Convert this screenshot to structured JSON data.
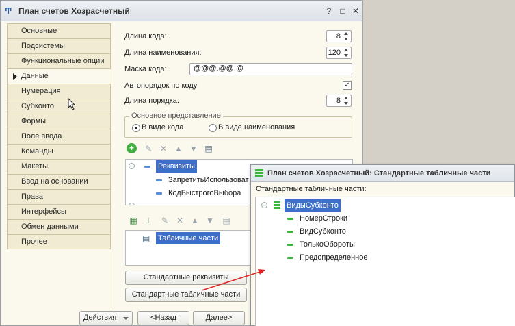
{
  "main_window": {
    "title": "План счетов Хозрасчетный",
    "icon": "chart-of-accounts-icon",
    "controls": [
      "?",
      "□",
      "✕"
    ]
  },
  "tabs": [
    {
      "label": "Основные",
      "active": false
    },
    {
      "label": "Подсистемы",
      "active": false
    },
    {
      "label": "Функциональные опции",
      "active": false
    },
    {
      "label": "Данные",
      "active": true
    },
    {
      "label": "Нумерация",
      "active": false
    },
    {
      "label": "Субконто",
      "active": false
    },
    {
      "label": "Формы",
      "active": false
    },
    {
      "label": "Поле ввода",
      "active": false
    },
    {
      "label": "Команды",
      "active": false
    },
    {
      "label": "Макеты",
      "active": false
    },
    {
      "label": "Ввод на основании",
      "active": false
    },
    {
      "label": "Права",
      "active": false
    },
    {
      "label": "Интерфейсы",
      "active": false
    },
    {
      "label": "Обмен данными",
      "active": false
    },
    {
      "label": "Прочее",
      "active": false
    }
  ],
  "data_panel": {
    "code_length_label": "Длина кода:",
    "code_length_value": "8",
    "name_length_label": "Длина наименования:",
    "name_length_value": "120",
    "code_mask_label": "Маска кода:",
    "code_mask_value": "@@@.@@.@",
    "auto_order_label": "Автопорядок по коду",
    "auto_order_checked": true,
    "order_length_label": "Длина порядка:",
    "order_length_value": "8",
    "main_presentation_title": "Основное представление",
    "radio_code_label": "В виде кода",
    "radio_name_label": "В виде наименования",
    "radio_selected": "code",
    "attributes_tree": {
      "root": "Реквизиты",
      "items": [
        "ЗапретитьИспользоват",
        "КодБыстрогоВыбора"
      ]
    },
    "tabular_tree": {
      "root": "Табличные части"
    },
    "standard_attributes_button": "Стандартные реквизиты",
    "standard_tabular_button": "Стандартные табличные части"
  },
  "bottom_buttons": {
    "actions": "Действия",
    "back": "<Назад",
    "next": "Далее>"
  },
  "popup": {
    "title": "План счетов Хозрасчетный: Стандартные табличные части",
    "label": "Стандартные табличные части:",
    "tree_root": "ВидыСубконто",
    "tree_items": [
      "НомерСтроки",
      "ВидСубконто",
      "ТолькоОбороты",
      "Предопределенное"
    ]
  },
  "colors": {
    "selection": "#3d6ec8",
    "annotation_arrow": "#e02020",
    "panel_bg": "#fbf9ee"
  }
}
